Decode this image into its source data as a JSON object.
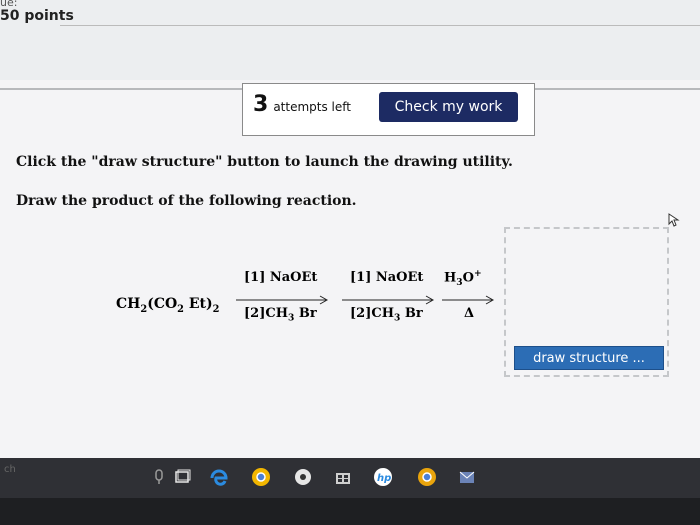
{
  "header": {
    "hint_text": "ue:",
    "points": "50 points"
  },
  "attempts": {
    "count": "3",
    "label": "attempts left",
    "check_label": "Check my work"
  },
  "instructions": {
    "line1": "Click the \"draw structure\" button to launch the drawing utility.",
    "line2": "Draw the product of the following reaction."
  },
  "reaction": {
    "step1_top": "[1] NaOEt",
    "step1_bottom": "[2]CH",
    "step2_top": "[1] NaOEt",
    "step2_bottom": "[2]CH",
    "step3_bottom": "Δ"
  },
  "draw": {
    "button_label": "draw structure ..."
  },
  "taskbar": {
    "search_hint": "ch",
    "icons": [
      "microphone-icon",
      "task-view-icon",
      "edge-icon",
      "chrome-icon",
      "media-icon",
      "store-icon",
      "hp-icon",
      "chrome-alt-icon",
      "mail-icon"
    ],
    "icon_colors": [
      "#9a9a9a",
      "#e8e8e8",
      "#2b8be0",
      "#f2b600",
      "#e6e6e6",
      "#cfcfcf",
      "#2b8be0",
      "#e9a40c",
      "#6b83b7"
    ]
  }
}
